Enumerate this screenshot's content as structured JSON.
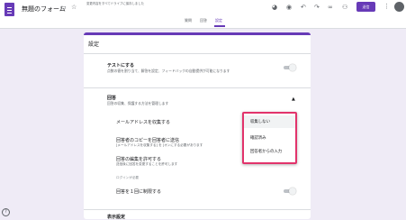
{
  "header": {
    "form_title": "無題のフォーム",
    "save_note": "変更内容をすべてドライブに保存しました",
    "send_label": "送信",
    "icons": [
      "folder-icon",
      "star-icon",
      "palette-icon",
      "preview-icon",
      "undo-icon",
      "redo-icon",
      "link-icon",
      "add-collaborator-icon",
      "more-icon"
    ]
  },
  "tabs": [
    {
      "label": "質問",
      "active": false
    },
    {
      "label": "回答",
      "active": false
    },
    {
      "label": "設定",
      "active": true
    }
  ],
  "colors": {
    "accent": "#673ab7",
    "highlight_border": "#e2336b",
    "background": "#efebf6"
  },
  "settings": {
    "title": "設定",
    "quiz": {
      "title": "テストにする",
      "desc": "点数の値を割り当て、解答を設定、フィードバックの自動提供が可能になります"
    },
    "responses": {
      "title": "回答",
      "desc": "回答の収集、保護する方法を管理します",
      "collect_email": "メールアドレスを収集する",
      "send_copy": "回答者のコピーを回答者に送信",
      "send_copy_sub": "[メールアドレスを収集する] を [オンにする必要があります",
      "allow_edit": "回答の編集を許可する",
      "allow_edit_sub": "送信後に回答を変更することを許可します",
      "requires_signin": "ログインが必要",
      "limit_one": "回答を１回に制限する"
    },
    "next_section_title": "表示設定"
  },
  "dropdown": {
    "options": [
      "収集しない",
      "確認済み",
      "回答者からの入力"
    ],
    "selected_index": 0
  }
}
